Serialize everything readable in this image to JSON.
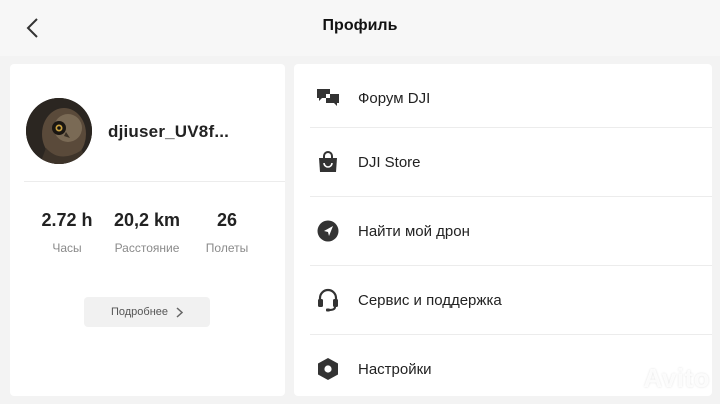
{
  "header": {
    "title": "Профиль",
    "back_icon": "chevron-left-icon"
  },
  "profile": {
    "username": "djiuser_UV8f...",
    "avatar": "owl-avatar",
    "stats": [
      {
        "value": "2.72 h",
        "label": "Часы"
      },
      {
        "value": "20,2 km",
        "label": "Расстояние"
      },
      {
        "value": "26",
        "label": "Полеты"
      }
    ],
    "more_label": "Подробнее"
  },
  "menu": {
    "items": [
      {
        "label": "Форум DJI",
        "icon": "forum-chat-icon"
      },
      {
        "label": "DJI Store",
        "icon": "shopping-bag-icon"
      },
      {
        "label": "Найти мой дрон",
        "icon": "locate-arrow-icon"
      },
      {
        "label": "Сервис и поддержка",
        "icon": "headset-icon"
      },
      {
        "label": "Настройки",
        "icon": "hexagon-settings-icon"
      }
    ]
  },
  "watermark": {
    "text": "Avito"
  },
  "colors": {
    "background": "#f3f3f3",
    "card": "#ffffff",
    "text": "#222222",
    "muted": "#8a8a8a"
  }
}
